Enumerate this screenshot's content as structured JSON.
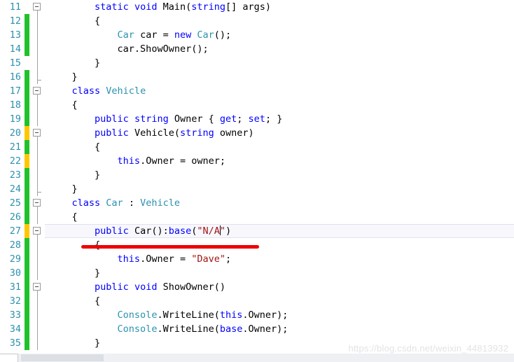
{
  "editor": {
    "language": "csharp",
    "first_visible_line": 11,
    "last_visible_line": 35,
    "current_line": 27,
    "colors": {
      "keyword": "#0000FF",
      "type": "#2B91AF",
      "string": "#A31515",
      "plain": "#000000",
      "line_number": "#2B91AF",
      "change_saved": "#1FC22B",
      "change_unsaved": "#FFC700",
      "current_line_bg": "#F7F7FC",
      "annotation": "#EE0000"
    },
    "lines": [
      {
        "number": "11",
        "change": "none",
        "fold": "box",
        "fold_line": "half-bottom",
        "indent": 8,
        "tokens": [
          {
            "t": "static",
            "c": "kw"
          },
          {
            "t": " ",
            "c": "pln"
          },
          {
            "t": "void",
            "c": "kw"
          },
          {
            "t": " Main(",
            "c": "pln"
          },
          {
            "t": "string",
            "c": "kw"
          },
          {
            "t": "[] args)",
            "c": "pln"
          }
        ]
      },
      {
        "number": "12",
        "change": "green",
        "fold": "line",
        "indent": 8,
        "tokens": [
          {
            "t": "{",
            "c": "pln"
          }
        ]
      },
      {
        "number": "13",
        "change": "green",
        "fold": "line",
        "indent": 12,
        "tokens": [
          {
            "t": "Car",
            "c": "typ"
          },
          {
            "t": " car = ",
            "c": "pln"
          },
          {
            "t": "new",
            "c": "kw"
          },
          {
            "t": " ",
            "c": "pln"
          },
          {
            "t": "Car",
            "c": "typ"
          },
          {
            "t": "();",
            "c": "pln"
          }
        ]
      },
      {
        "number": "14",
        "change": "green",
        "fold": "line",
        "indent": 12,
        "tokens": [
          {
            "t": "car.ShowOwner();",
            "c": "pln"
          }
        ]
      },
      {
        "number": "15",
        "change": "none",
        "fold": "line",
        "indent": 8,
        "tokens": [
          {
            "t": "}",
            "c": "pln"
          }
        ]
      },
      {
        "number": "16",
        "change": "green",
        "fold": "tick",
        "indent": 4,
        "tokens": [
          {
            "t": "}",
            "c": "pln"
          }
        ]
      },
      {
        "number": "17",
        "change": "green",
        "fold": "box",
        "fold_line": "half-bottom",
        "indent": 4,
        "tokens": [
          {
            "t": "class",
            "c": "kw"
          },
          {
            "t": " ",
            "c": "pln"
          },
          {
            "t": "Vehicle",
            "c": "typ"
          }
        ]
      },
      {
        "number": "18",
        "change": "green",
        "fold": "line",
        "indent": 4,
        "tokens": [
          {
            "t": "{",
            "c": "pln"
          }
        ]
      },
      {
        "number": "19",
        "change": "green",
        "fold": "line",
        "indent": 8,
        "tokens": [
          {
            "t": "public",
            "c": "kw"
          },
          {
            "t": " ",
            "c": "pln"
          },
          {
            "t": "string",
            "c": "kw"
          },
          {
            "t": " Owner { ",
            "c": "pln"
          },
          {
            "t": "get",
            "c": "kw"
          },
          {
            "t": "; ",
            "c": "pln"
          },
          {
            "t": "set",
            "c": "kw"
          },
          {
            "t": "; }",
            "c": "pln"
          }
        ]
      },
      {
        "number": "20",
        "change": "yellow",
        "fold": "box",
        "fold_line": "half-bottom",
        "indent": 8,
        "tokens": [
          {
            "t": "public",
            "c": "kw"
          },
          {
            "t": " Vehicle(",
            "c": "pln"
          },
          {
            "t": "string",
            "c": "kw"
          },
          {
            "t": " owner)",
            "c": "pln"
          }
        ]
      },
      {
        "number": "21",
        "change": "green",
        "fold": "line",
        "indent": 8,
        "tokens": [
          {
            "t": "{",
            "c": "pln"
          }
        ]
      },
      {
        "number": "22",
        "change": "yellow",
        "fold": "line",
        "indent": 12,
        "tokens": [
          {
            "t": "this",
            "c": "kw"
          },
          {
            "t": ".Owner = owner;",
            "c": "pln"
          }
        ]
      },
      {
        "number": "23",
        "change": "green",
        "fold": "line",
        "indent": 8,
        "tokens": [
          {
            "t": "}",
            "c": "pln"
          }
        ]
      },
      {
        "number": "24",
        "change": "green",
        "fold": "tick",
        "indent": 4,
        "tokens": [
          {
            "t": "}",
            "c": "pln"
          }
        ]
      },
      {
        "number": "25",
        "change": "green",
        "fold": "box",
        "fold_line": "half-bottom",
        "indent": 4,
        "tokens": [
          {
            "t": "class",
            "c": "kw"
          },
          {
            "t": " ",
            "c": "pln"
          },
          {
            "t": "Car",
            "c": "typ"
          },
          {
            "t": " : ",
            "c": "pln"
          },
          {
            "t": "Vehicle",
            "c": "typ"
          }
        ]
      },
      {
        "number": "26",
        "change": "green",
        "fold": "line",
        "indent": 4,
        "tokens": [
          {
            "t": "{",
            "c": "pln"
          }
        ]
      },
      {
        "number": "27",
        "change": "yellow",
        "fold": "box",
        "fold_line": "half-bottom",
        "current": true,
        "indent": 8,
        "tokens": [
          {
            "t": "public",
            "c": "kw"
          },
          {
            "t": " Car():",
            "c": "pln"
          },
          {
            "t": "base",
            "c": "kw"
          },
          {
            "t": "(",
            "c": "pln"
          },
          {
            "t": "\"N/A",
            "c": "str"
          },
          {
            "t": "CARET",
            "c": "caret"
          },
          {
            "t": "\"",
            "c": "str"
          },
          {
            "t": ")",
            "c": "pln"
          }
        ]
      },
      {
        "number": "28",
        "change": "green",
        "fold": "line",
        "indent": 8,
        "tokens": [
          {
            "t": "{",
            "c": "pln"
          }
        ]
      },
      {
        "number": "29",
        "change": "green",
        "fold": "line",
        "indent": 12,
        "tokens": [
          {
            "t": "this",
            "c": "kw"
          },
          {
            "t": ".Owner = ",
            "c": "pln"
          },
          {
            "t": "\"Dave\"",
            "c": "str"
          },
          {
            "t": ";",
            "c": "pln"
          }
        ]
      },
      {
        "number": "30",
        "change": "green",
        "fold": "line",
        "indent": 8,
        "tokens": [
          {
            "t": "}",
            "c": "pln"
          }
        ]
      },
      {
        "number": "31",
        "change": "green",
        "fold": "box",
        "fold_line": "half-bottom",
        "indent": 8,
        "tokens": [
          {
            "t": "public",
            "c": "kw"
          },
          {
            "t": " ",
            "c": "pln"
          },
          {
            "t": "void",
            "c": "kw"
          },
          {
            "t": " ShowOwner()",
            "c": "pln"
          }
        ]
      },
      {
        "number": "32",
        "change": "green",
        "fold": "line",
        "indent": 8,
        "tokens": [
          {
            "t": "{",
            "c": "pln"
          }
        ]
      },
      {
        "number": "33",
        "change": "green",
        "fold": "line",
        "indent": 12,
        "tokens": [
          {
            "t": "Console",
            "c": "typ"
          },
          {
            "t": ".WriteLine(",
            "c": "pln"
          },
          {
            "t": "this",
            "c": "kw"
          },
          {
            "t": ".Owner);",
            "c": "pln"
          }
        ]
      },
      {
        "number": "34",
        "change": "green",
        "fold": "line",
        "indent": 12,
        "tokens": [
          {
            "t": "Console",
            "c": "typ"
          },
          {
            "t": ".WriteLine(",
            "c": "pln"
          },
          {
            "t": "base",
            "c": "kw"
          },
          {
            "t": ".Owner);",
            "c": "pln"
          }
        ]
      },
      {
        "number": "35",
        "change": "green",
        "fold": "line",
        "indent": 8,
        "tokens": [
          {
            "t": "}",
            "c": "pln"
          }
        ]
      }
    ]
  },
  "annotation": {
    "type": "red-underline",
    "target_line": "27"
  },
  "watermark": {
    "text": "https://blog.csdn.net/weixin_44813932"
  }
}
